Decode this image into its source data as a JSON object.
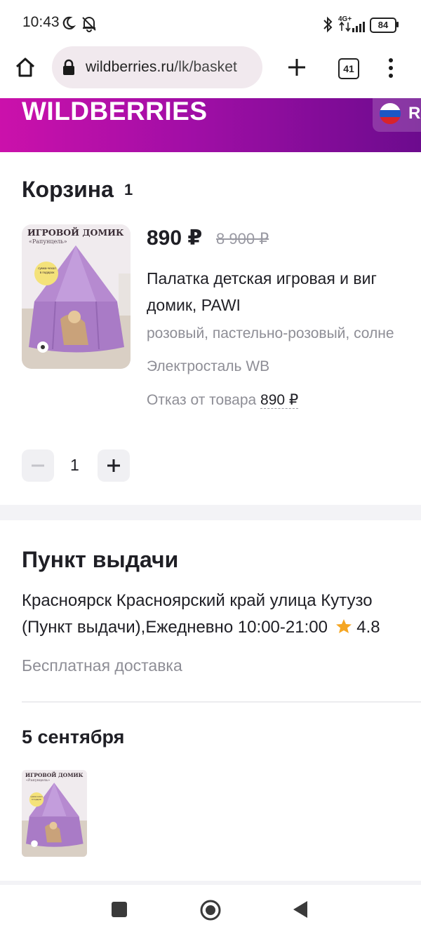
{
  "status_bar": {
    "time": "10:43",
    "network": "4G+",
    "battery": "84"
  },
  "browser": {
    "url_domain": "wildberries.ru",
    "url_path": "/lk/basket",
    "tab_count": "41"
  },
  "header": {
    "logo": "WILDBERRIES",
    "region_letter": "R"
  },
  "basket": {
    "title": "Корзина",
    "count": "1",
    "item": {
      "image_title": "ИГРОВОЙ ДОМИК",
      "image_subtitle": "«Рапунцель»",
      "image_badge": "сумка-чехол в подарок",
      "price": "890 ₽",
      "old_price": "8 900 ₽",
      "name_line1": "Палатка детская игровая и виг",
      "name_line2": "домик, PAWI",
      "color": "розовый, пастельно-розовый, солне",
      "warehouse": "Электросталь WB",
      "refuse_label": "Отказ от товара",
      "refuse_price": "890 ₽",
      "quantity": "1"
    }
  },
  "pickup": {
    "title": "Пункт выдачи",
    "address_line1": "Красноярск Красноярский край улица Кутузо",
    "address_line2": "(Пункт выдачи),Ежедневно 10:00-21:00",
    "rating": "4.8",
    "delivery": "Бесплатная доставка"
  },
  "delivery_date": {
    "title": "5 сентября"
  },
  "colors": {
    "brand_start": "#cb11ab",
    "brand_end": "#6c0b8e",
    "star": "#f5a623"
  }
}
